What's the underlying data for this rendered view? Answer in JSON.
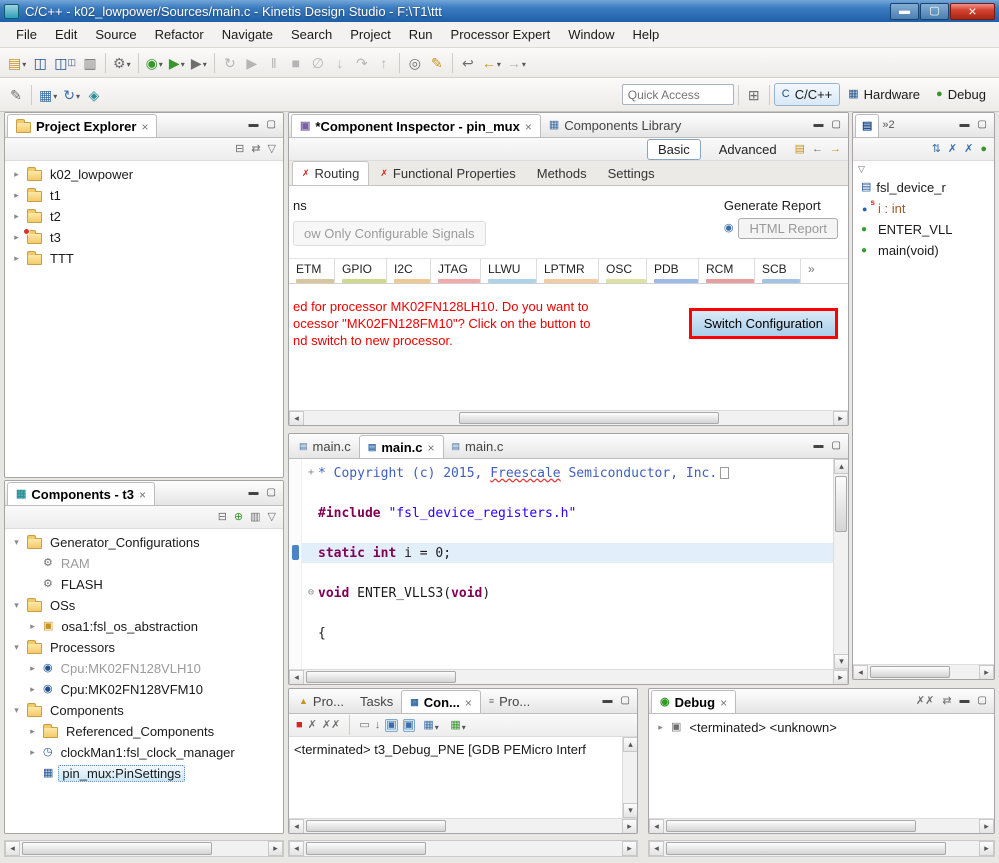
{
  "window": {
    "title": "C/C++ - k02_lowpower/Sources/main.c - Kinetis Design Studio - F:\\T1\\ttt"
  },
  "menubar": {
    "items": [
      "File",
      "Edit",
      "Source",
      "Refactor",
      "Navigate",
      "Search",
      "Project",
      "Run",
      "Processor Expert",
      "Window",
      "Help"
    ]
  },
  "toolbar": {
    "quick_access_label": "Quick Access",
    "perspectives": {
      "cpp": "C/C++",
      "hardware": "Hardware",
      "debug": "Debug"
    }
  },
  "project_explorer": {
    "title": "Project Explorer",
    "items": [
      "k02_lowpower",
      "t1",
      "t2",
      "t3",
      "TTT"
    ]
  },
  "components_view": {
    "title": "Components - t3",
    "nodes": {
      "generator": "Generator_Configurations",
      "ram": "RAM",
      "flash": "FLASH",
      "oss": "OSs",
      "osa1": "osa1:fsl_os_abstraction",
      "processors": "Processors",
      "cpu1": "Cpu:MK02FN128VLH10",
      "cpu2": "Cpu:MK02FN128VFM10",
      "components": "Components",
      "referenced": "Referenced_Components",
      "clockman": "clockMan1:fsl_clock_manager",
      "pinmux": "pin_mux:PinSettings"
    }
  },
  "inspector": {
    "tab_active": "*Component Inspector - pin_mux",
    "tab_library": "Components Library",
    "basic_label": "Basic",
    "advanced_label": "Advanced",
    "tabs": [
      "Routing",
      "Functional Properties",
      "Methods",
      "Settings"
    ],
    "pins_label": "ns",
    "filter_label": "ow Only Configurable Signals",
    "generate_report_label": "Generate Report",
    "html_report_button": "HTML Report",
    "columns": [
      "ETM",
      "GPIO",
      "I2C",
      "JTAG",
      "LLWU",
      "LPTMR",
      "OSC",
      "PDB",
      "RCM",
      "SCB"
    ],
    "overflow_indicator": "»",
    "column_colors": [
      "#d8c79e",
      "#cfd98e",
      "#f0c892",
      "#f2a9a9",
      "#aed2ea",
      "#f5cba4",
      "#dde2a2",
      "#9db9e8",
      "#eb9d9d",
      "#a2c3e6"
    ],
    "warning_line1": "ed for processor MK02FN128LH10. Do you want to",
    "warning_line2": "ocessor \"MK02FN128FM10\"? Click on the button to",
    "warning_line3": "nd switch to new processor.",
    "switch_button": "Switch Configuration"
  },
  "editor": {
    "tabs": [
      "main.c",
      "main.c",
      "main.c"
    ],
    "lines": [
      {
        "segs": [
          {
            "t": "* Copyright (c) 2015, "
          },
          {
            "t": "Freescale"
          },
          {
            "t": " Semiconductor, Inc."
          }
        ]
      },
      {
        "segs": []
      },
      {
        "segs": [
          {
            "t": "#include"
          },
          {
            "t": " "
          },
          {
            "t": "\"fsl_device_registers.h\""
          }
        ]
      },
      {
        "segs": []
      },
      {
        "segs": [
          {
            "t": "static int"
          },
          {
            "t": " i = 0;"
          }
        ]
      },
      {
        "segs": []
      },
      {
        "segs": [
          {
            "t": "void"
          },
          {
            "t": " ENTER_VLLS3("
          },
          {
            "t": "void"
          },
          {
            "t": ")"
          }
        ]
      },
      {
        "segs": []
      },
      {
        "segs": [
          {
            "t": "{"
          }
        ]
      }
    ]
  },
  "outline": {
    "more_tabs": "»2",
    "items": [
      "fsl_device_r",
      "i : int",
      "ENTER_VLL",
      "main(void)"
    ]
  },
  "console": {
    "tab_problems": "Pro...",
    "tab_tasks": "Tasks",
    "tab_console": "Con...",
    "tab_properties": "Pro...",
    "text": "<terminated> t3_Debug_PNE [GDB PEMicro Interf"
  },
  "debug_view": {
    "title": "Debug",
    "item": "<terminated> <unknown>"
  },
  "colors": {
    "highlight_border": "#ff0000",
    "warning_text": "#ee0000",
    "keyword": "#7f0055",
    "string": "#2a00ff",
    "comment": "#3f5fbf",
    "selection_bg": "#cde6f7"
  }
}
